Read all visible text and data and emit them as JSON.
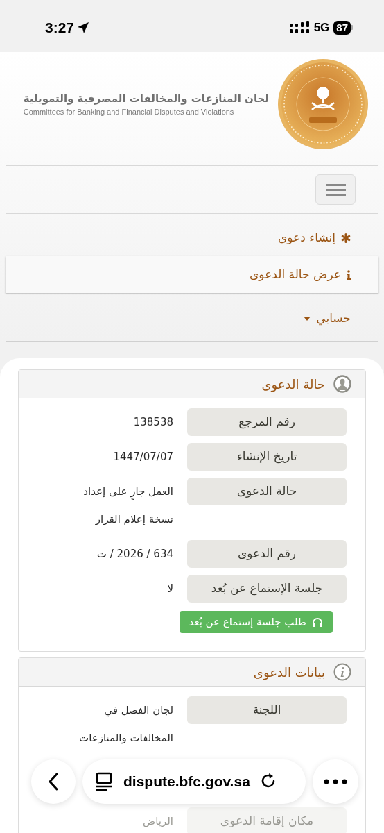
{
  "status_bar": {
    "time": "3:27",
    "network": "5G",
    "battery": "87"
  },
  "header": {
    "title_ar": "لجان المنازعات والمخالفات المصرفية والتمويلية",
    "title_en": "Committees for Banking and Financial Disputes and Violations"
  },
  "nav": {
    "items": [
      {
        "label": "إنشاء دعوى",
        "selected": false
      },
      {
        "label": "عرض حالة الدعوى",
        "selected": true
      },
      {
        "label": "حسابي",
        "selected": false
      }
    ]
  },
  "panels": [
    {
      "title": "حالة الدعوى",
      "rows": [
        {
          "label": "رقم المرجع",
          "value": "138538"
        },
        {
          "label": "تاريخ الإنشاء",
          "value": "1447/07/07"
        },
        {
          "label": "حالة الدعوى",
          "value": "العمل جارٍ على إعداد نسخة إعلام القرار"
        },
        {
          "label": "رقم الدعوى",
          "value": "634 / 2026 / ت"
        },
        {
          "label": "جلسة الإستماع عن بُعد",
          "value": "لا"
        }
      ],
      "button": {
        "label": "طلب جلسة إستماع عن بُعد"
      }
    },
    {
      "title": "بيانات الدعوى",
      "rows": [
        {
          "label": "اللجنة",
          "value": "لجان الفصل في المخالفات والمنازعات"
        },
        {
          "label": "مكان إقامة الدعوى",
          "value": "الرياض",
          "faded": true
        }
      ]
    }
  ],
  "browser_bar": {
    "url": "dispute.bfc.gov.sa"
  }
}
